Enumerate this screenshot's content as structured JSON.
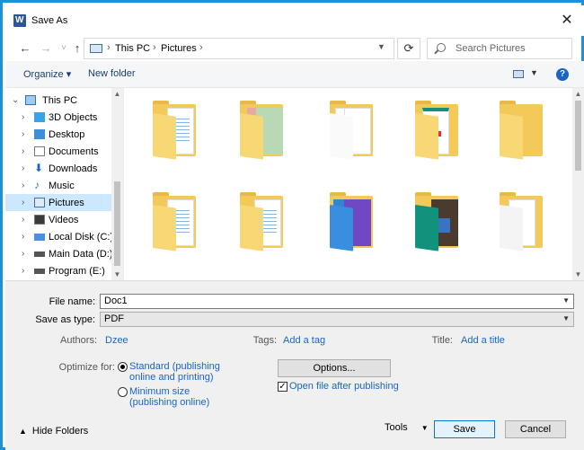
{
  "window": {
    "title": "Save As"
  },
  "icons": {
    "app": "word-icon",
    "close": "close-icon"
  },
  "nav": {
    "back": "←",
    "forward": "→",
    "recent": "˅",
    "up": "↑",
    "breadcrumbs": [
      "This PC",
      "Pictures"
    ],
    "refresh": "⟳",
    "search_placeholder": "Search Pictures"
  },
  "toolbar": {
    "organize": "Organize ▾",
    "new_folder": "New folder",
    "help": "?"
  },
  "tree": [
    {
      "label": "This PC",
      "icon": "pc-icon",
      "expanded": true
    },
    {
      "label": "3D Objects",
      "icon": "cube-icon"
    },
    {
      "label": "Desktop",
      "icon": "desktop-icon"
    },
    {
      "label": "Documents",
      "icon": "documents-icon"
    },
    {
      "label": "Downloads",
      "icon": "download-icon"
    },
    {
      "label": "Music",
      "icon": "music-icon"
    },
    {
      "label": "Pictures",
      "icon": "pictures-icon",
      "selected": true
    },
    {
      "label": "Videos",
      "icon": "video-icon"
    },
    {
      "label": "Local Disk (C:)",
      "icon": "disk-icon"
    },
    {
      "label": "Main Data (D:)",
      "icon": "disk-icon"
    },
    {
      "label": "Program (E:)",
      "icon": "disk-icon"
    }
  ],
  "folders": [
    {
      "kind": "docs"
    },
    {
      "kind": "pink"
    },
    {
      "kind": "white"
    },
    {
      "kind": "green-doc"
    },
    {
      "kind": "plain"
    },
    {
      "kind": "docs"
    },
    {
      "kind": "docs"
    },
    {
      "kind": "blue-purple"
    },
    {
      "kind": "teal-photo"
    },
    {
      "kind": "white"
    }
  ],
  "form": {
    "filename_label": "File name:",
    "filename_value": "Doc1",
    "savetype_label": "Save as type:",
    "savetype_value": "PDF",
    "authors_label": "Authors:",
    "authors_value": "Dzee",
    "tags_label": "Tags:",
    "tags_value": "Add a tag",
    "title_label": "Title:",
    "title_value": "Add a title",
    "optimize_label": "Optimize for:",
    "opt_standard": "Standard (publishing online and printing)",
    "opt_standard_l1": "Standard (publishing",
    "opt_standard_l2": "online and printing)",
    "opt_min_l1": "Minimum size",
    "opt_min_l2": "(publishing online)",
    "options_button": "Options...",
    "open_after": "Open file after publishing"
  },
  "footer": {
    "hide_folders": "Hide Folders",
    "tools": "Tools",
    "save": "Save",
    "cancel": "Cancel"
  },
  "colors": {
    "frame": "#1e90d6",
    "link": "#1a64c8",
    "selection": "#cce8ff",
    "folder": "#f3c95a"
  }
}
